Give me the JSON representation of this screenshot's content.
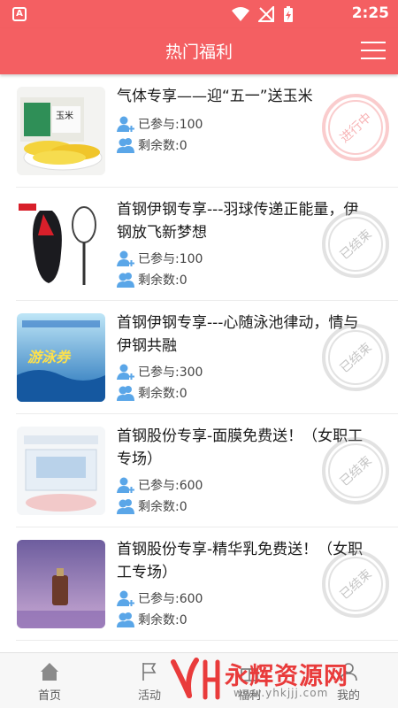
{
  "status_bar": {
    "time": "2:25",
    "app_icon_letter": "A"
  },
  "header": {
    "title": "热门福利"
  },
  "list": [
    {
      "title": "气体专享——迎“五一”送玉米",
      "joined": "已参与:100",
      "remaining": "剩余数:0",
      "stamp": "进行中",
      "stamp_state": "active",
      "thumb_text": ""
    },
    {
      "title": "首钢伊钢专享---羽球传递正能量，伊钢放飞新梦想",
      "joined": "已参与:100",
      "remaining": "剩余数:0",
      "stamp": "已结束",
      "stamp_state": "ended",
      "thumb_text": ""
    },
    {
      "title": "首钢伊钢专享---心随泳池律动，情与伊钢共融",
      "joined": "已参与:300",
      "remaining": "剩余数:0",
      "stamp": "已结束",
      "stamp_state": "ended",
      "thumb_text": "游泳券"
    },
    {
      "title": "首钢股份专享-面膜免费送！（女职工专场）",
      "joined": "已参与:600",
      "remaining": "剩余数:0",
      "stamp": "已结束",
      "stamp_state": "ended",
      "thumb_text": ""
    },
    {
      "title": "首钢股份专享-精华乳免费送！（女职工专场）",
      "joined": "已参与:600",
      "remaining": "剩余数:0",
      "stamp": "已结束",
      "stamp_state": "ended",
      "thumb_text": ""
    }
  ],
  "tabs": [
    {
      "label": "首页",
      "icon": "home-icon"
    },
    {
      "label": "活动",
      "icon": "flag-icon"
    },
    {
      "label": "福利",
      "icon": "gift-icon"
    },
    {
      "label": "我的",
      "icon": "user-icon"
    }
  ],
  "watermark": {
    "logo": "YH",
    "brand": "永辉资源网",
    "url": "www.yhkjjj.com"
  },
  "colors": {
    "header": "#f45f62",
    "icon_blue": "#5aa6e8",
    "stamp_active": "#ee5558",
    "stamp_ended": "#a0a0a0"
  }
}
